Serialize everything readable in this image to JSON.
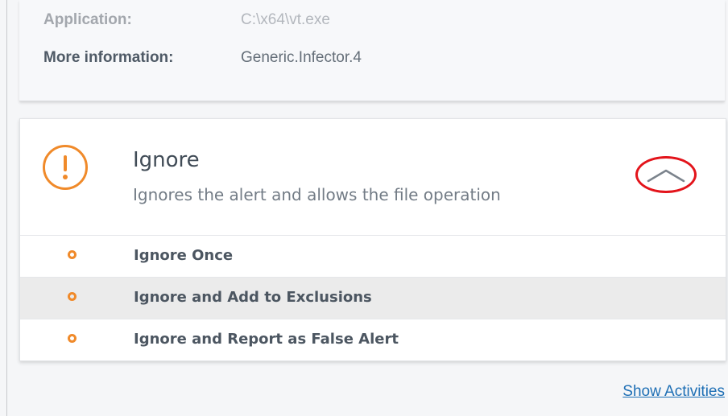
{
  "info": {
    "application_label": "Application:",
    "application_value": "C:\\x64\\vt.exe",
    "more_info_label": "More information:",
    "more_info_value": "Generic.Infector.4"
  },
  "ignore_section": {
    "title": "Ignore",
    "description": "Ignores the alert and allows the file operation",
    "icon": "exclamation-circle-icon",
    "collapse_icon": "chevron-up-icon",
    "options": [
      {
        "label": "Ignore Once"
      },
      {
        "label": "Ignore and Add to Exclusions"
      },
      {
        "label": "Ignore and Report as False Alert"
      }
    ]
  },
  "footer": {
    "show_activities_label": "Show Activities"
  },
  "colors": {
    "accent_orange": "#f08a2a",
    "highlight_red": "#e3141b",
    "link_blue": "#1e6fb5"
  }
}
